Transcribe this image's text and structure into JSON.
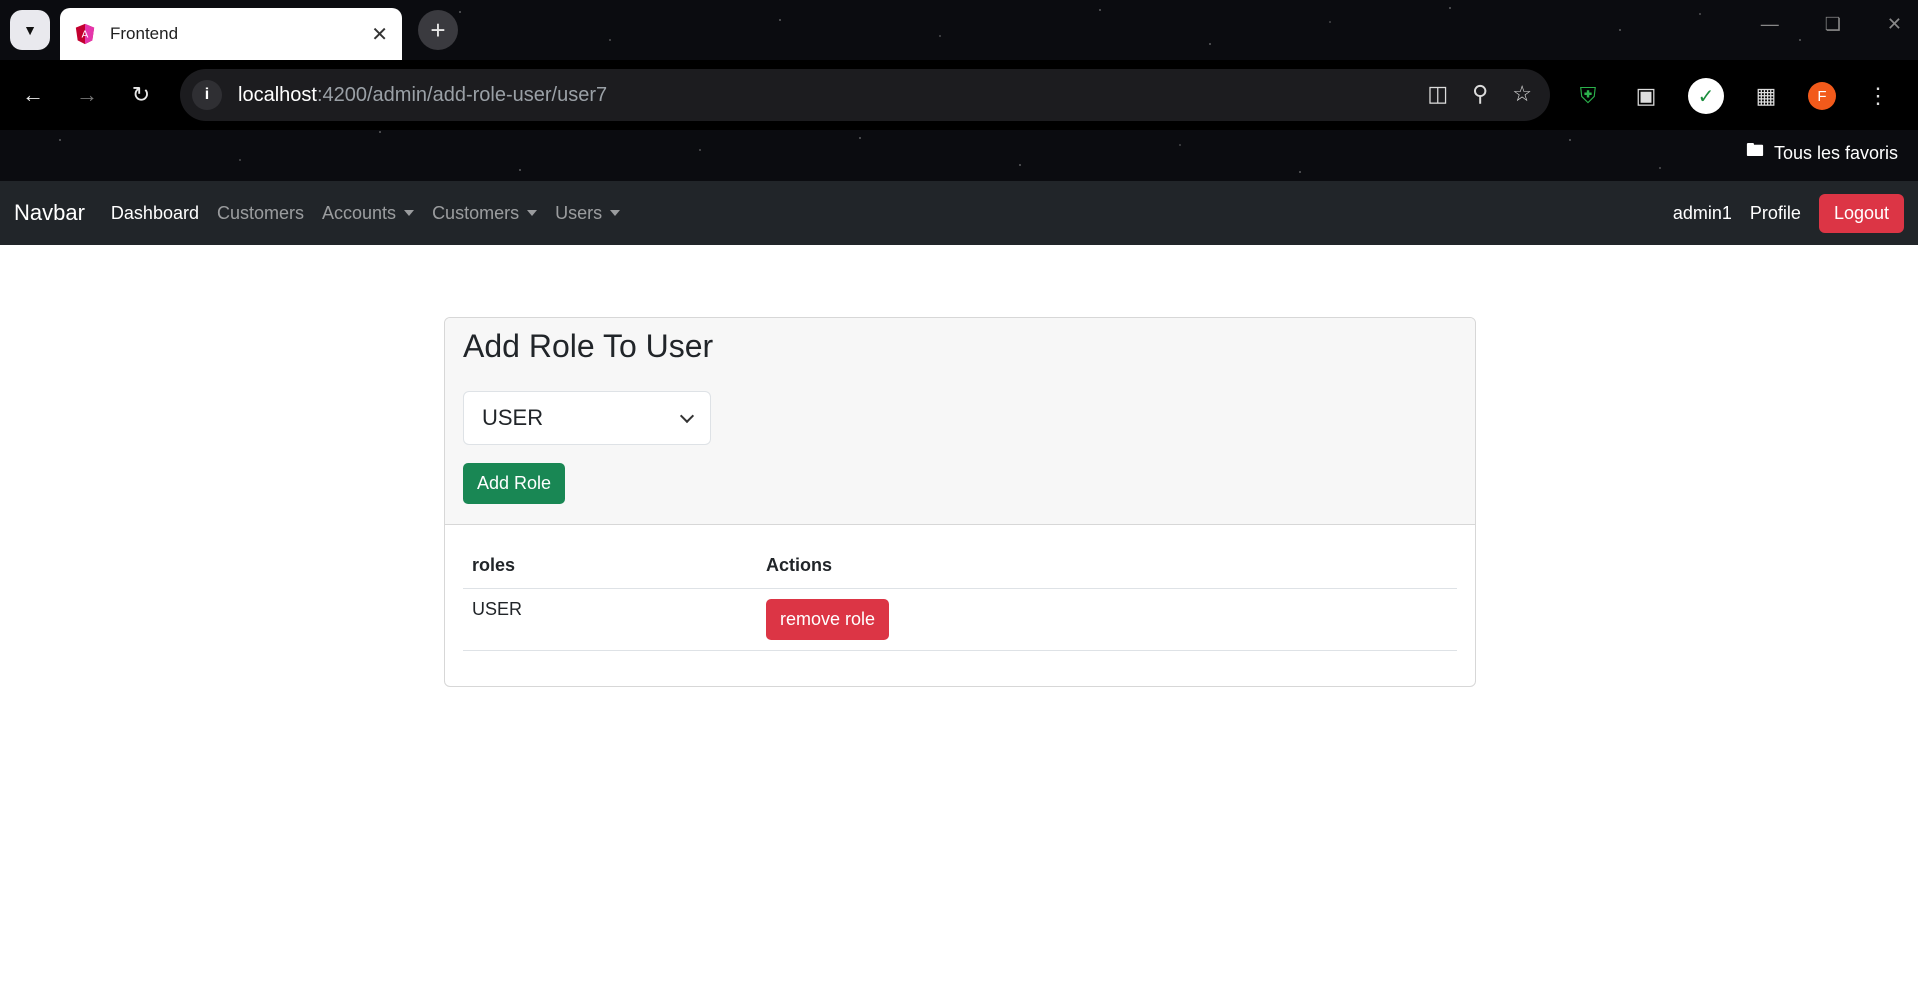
{
  "browser": {
    "tab_title": "Frontend",
    "url_host": "localhost",
    "url_path": ":4200/admin/add-role-user/user7",
    "profile_initial": "F",
    "bookmarks_label": "Tous les favoris"
  },
  "navbar": {
    "brand": "Navbar",
    "links": [
      {
        "label": "Dashboard"
      },
      {
        "label": "Customers"
      },
      {
        "label": "Accounts"
      },
      {
        "label": "Customers"
      },
      {
        "label": "Users"
      }
    ],
    "username": "admin1",
    "profile_label": "Profile",
    "logout_label": "Logout"
  },
  "card": {
    "title": "Add Role To User",
    "select_value": "USER",
    "add_button": "Add Role",
    "table": {
      "headers": [
        "roles",
        "Actions"
      ],
      "rows": [
        {
          "role": "USER",
          "action": "remove role"
        }
      ]
    }
  },
  "colors": {
    "navbar_bg": "#212529",
    "danger": "#dc3545",
    "success": "#198754"
  }
}
